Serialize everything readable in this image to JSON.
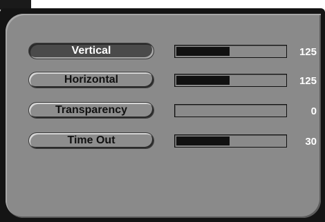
{
  "colors": {
    "frame": "#141414",
    "panel": "#8a8a8a",
    "active_button": "#4a4a4a",
    "slider_fill": "#111111",
    "value_text": "#ffffff"
  },
  "menu": {
    "items": [
      {
        "label": "Vertical",
        "value": "125",
        "fill_fraction": 0.49,
        "active": true
      },
      {
        "label": "Horizontal",
        "value": "125",
        "fill_fraction": 0.49,
        "active": false
      },
      {
        "label": "Transparency",
        "value": "0",
        "fill_fraction": 0,
        "active": false
      },
      {
        "label": "Time Out",
        "value": "30",
        "fill_fraction": 0.49,
        "active": false
      }
    ]
  }
}
